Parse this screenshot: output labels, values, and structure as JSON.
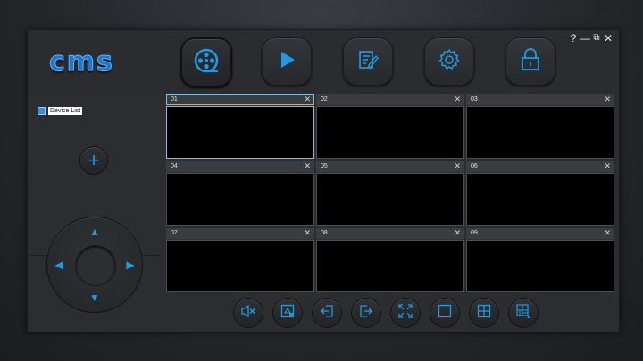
{
  "app": {
    "logo_text": "cms",
    "brand_color": "#1d78c8",
    "accent_color": "#1e9be8"
  },
  "nav": {
    "items": [
      {
        "name": "live-view",
        "icon": "film-reel-icon",
        "active": true
      },
      {
        "name": "playback",
        "icon": "play-icon",
        "active": false
      },
      {
        "name": "logs",
        "icon": "edit-document-icon",
        "active": false
      },
      {
        "name": "settings",
        "icon": "gear-icon",
        "active": false
      },
      {
        "name": "lock",
        "icon": "lock-icon",
        "active": false
      }
    ]
  },
  "window_controls": {
    "help": "?",
    "minimize": "—",
    "restore": "⧉",
    "close": "✕"
  },
  "sidebar": {
    "device_list_label": "Device List",
    "add_label": "+"
  },
  "ptz": {
    "up": "▲",
    "down": "▼",
    "left": "◀",
    "right": "▶"
  },
  "channels": [
    {
      "num": "01",
      "close": "✕",
      "active": true
    },
    {
      "num": "02",
      "close": "✕",
      "active": false
    },
    {
      "num": "03",
      "close": "✕",
      "active": false
    },
    {
      "num": "04",
      "close": "✕",
      "active": false
    },
    {
      "num": "05",
      "close": "✕",
      "active": false
    },
    {
      "num": "06",
      "close": "✕",
      "active": false
    },
    {
      "num": "07",
      "close": "✕",
      "active": false
    },
    {
      "num": "08",
      "close": "✕",
      "active": false
    },
    {
      "num": "09",
      "close": "✕",
      "active": false
    }
  ],
  "toolbar": {
    "buttons": [
      {
        "name": "mute",
        "icon": "speaker-mute-icon"
      },
      {
        "name": "snapshot",
        "icon": "snapshot-icon"
      },
      {
        "name": "import",
        "icon": "import-icon"
      },
      {
        "name": "export",
        "icon": "export-icon"
      },
      {
        "name": "fullscreen",
        "icon": "fullscreen-icon"
      },
      {
        "name": "layout-1",
        "icon": "layout-single-icon"
      },
      {
        "name": "layout-4",
        "icon": "layout-quad-icon"
      },
      {
        "name": "layout-custom",
        "icon": "layout-custom-icon"
      }
    ]
  }
}
